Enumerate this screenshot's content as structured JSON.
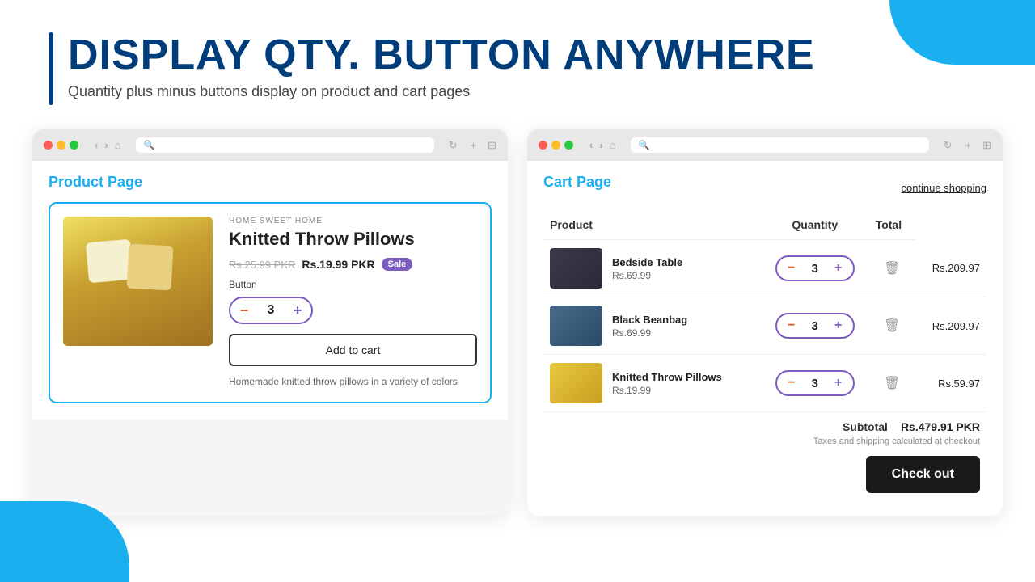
{
  "page": {
    "title": "DISPLAY QTY. BUTTON ANYWHERE",
    "subtitle": "Quantity plus minus buttons display on product and cart pages"
  },
  "blobs": {
    "top_right": true,
    "bottom_left": true
  },
  "product_panel": {
    "browser_title": "",
    "page_label": "Product Page",
    "product": {
      "brand": "HOME SWEET HOME",
      "name": "Knitted Throw Pillows",
      "original_price": "Rs.25.99 PKR",
      "sale_price": "Rs.19.99 PKR",
      "sale_badge": "Sale",
      "button_label": "Button",
      "qty": "3",
      "add_to_cart": "Add to cart",
      "description": "Homemade knitted throw pillows in a variety of colors"
    }
  },
  "cart_panel": {
    "page_label": "Cart Page",
    "continue_shopping": "continue shopping",
    "table": {
      "headers": [
        "Product",
        "Quantity",
        "Total"
      ],
      "rows": [
        {
          "image_type": "bedside",
          "name": "Bedside Table",
          "price": "Rs.69.99",
          "qty": "3",
          "total": "Rs.209.97"
        },
        {
          "image_type": "beanbag",
          "name": "Black Beanbag",
          "price": "Rs.69.99",
          "qty": "3",
          "total": "Rs.209.97"
        },
        {
          "image_type": "pillows",
          "name": "Knitted Throw Pillows",
          "price": "Rs.19.99",
          "qty": "3",
          "total": "Rs.59.97"
        }
      ]
    },
    "subtotal_label": "Subtotal",
    "subtotal_value": "Rs.479.91 PKR",
    "tax_note": "Taxes and shipping calculated at checkout",
    "checkout_btn": "Check out"
  }
}
